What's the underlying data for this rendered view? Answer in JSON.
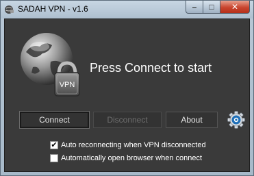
{
  "window": {
    "title": "SADAH VPN - v1.6",
    "controls": {
      "minimize": "–",
      "maximize": "□",
      "close": "✕"
    }
  },
  "main": {
    "heading": "Press Connect to start",
    "logo_text": "VPN",
    "buttons": {
      "connect": "Connect",
      "disconnect": "Disconnect",
      "about": "About"
    },
    "options": [
      {
        "label": "Auto reconnecting when VPN disconnected",
        "checked": true,
        "mark": "✔"
      },
      {
        "label": "Automatically open browser when connect",
        "checked": false,
        "mark": ""
      }
    ]
  },
  "colors": {
    "client_background": "#3a3a3a",
    "close_button": "#c9452e",
    "gear_accent": "#1e6fb8"
  },
  "icons": {
    "app": "vpn-app-icon",
    "logo": "globe-padlock-icon",
    "settings": "gear-icon"
  }
}
